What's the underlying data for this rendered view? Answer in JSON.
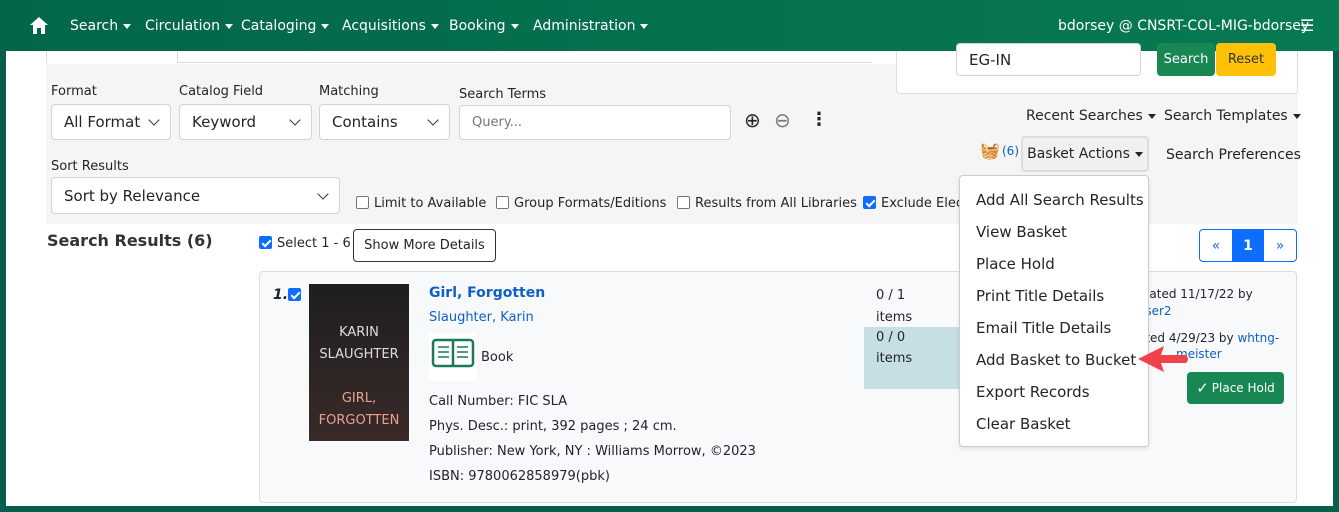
{
  "nav": {
    "items": [
      "Search",
      "Circulation",
      "Cataloging",
      "Acquisitions",
      "Booking",
      "Administration"
    ],
    "user": "bdorsey @ CNSRT-COL-MIG-bdorsey"
  },
  "search": {
    "format_label": "Format",
    "format_value": "All Format",
    "field_label": "Catalog Field",
    "field_value": "Keyword",
    "matching_label": "Matching",
    "matching_value": "Contains",
    "terms_label": "Search Terms",
    "terms_placeholder": "Query...",
    "sort_label": "Sort Results",
    "sort_value": "Sort by Relevance",
    "org_value": "EG-IN",
    "search_btn": "Search",
    "reset_btn": "Reset",
    "recent": "Recent Searches",
    "templates": "Search Templates",
    "basket_count": "(6)",
    "basket_actions": "Basket Actions",
    "preferences": "Search Preferences",
    "checks": [
      {
        "label": "Limit to Available",
        "checked": false
      },
      {
        "label": "Group Formats/Editions",
        "checked": false
      },
      {
        "label": "Results from All Libraries",
        "checked": false
      },
      {
        "label": "Exclude Elect",
        "checked": true
      }
    ]
  },
  "results": {
    "heading": "Search Results (6)",
    "select_label": "Select 1 - 6",
    "more_details": "Show More Details",
    "pager": [
      "«",
      "1",
      "»"
    ]
  },
  "record": {
    "num": "1.",
    "title": "Girl, Forgotten",
    "author": "Slaughter, Karin",
    "format": "Book",
    "call": "Call Number: FIC SLA",
    "phys": "Phys. Desc.: print, 392 pages ; 24 cm.",
    "pub": "Publisher: New York, NY : Williams Morrow, ©2023",
    "isbn": "ISBN: 9780062858979(pbk)",
    "cover_text": "KARIN SLAUGHTER GIRL, FORGOTTEN",
    "holdings": [
      {
        "count": "0 / 1",
        "unit": "items"
      },
      {
        "count": "0 / 0",
        "unit": "items"
      }
    ],
    "created": "eated 11/17/22 by",
    "created_by": "iser2",
    "edited": "ited 4/29/23 by",
    "edited_by_a": "whtng-",
    "edited_by_b": "meister",
    "place_hold": "Place Hold"
  },
  "menu": [
    "Add All Search Results",
    "View Basket",
    "Place Hold",
    "Print Title Details",
    "Email Title Details",
    "Add Basket to Bucket",
    "Export Records",
    "Clear Basket"
  ],
  "colors": {
    "nav": "#077a52",
    "accent": "#198754",
    "warn": "#ffc107",
    "arrow": "#f0424a"
  }
}
